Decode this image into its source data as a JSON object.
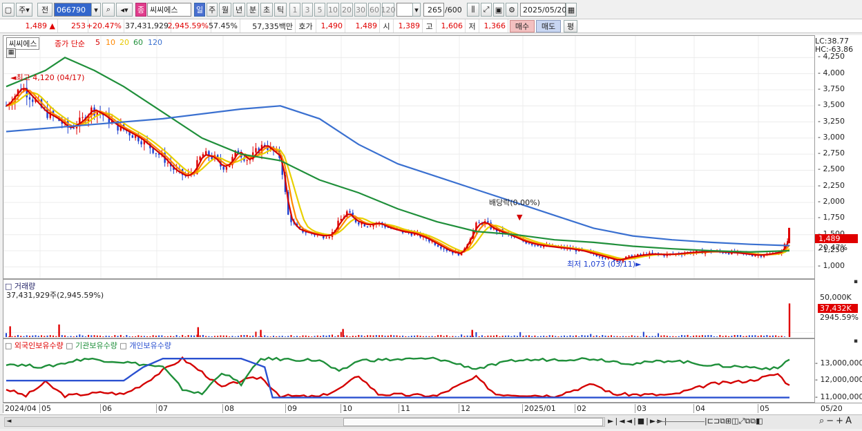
{
  "toolbar": {
    "week_label": "주",
    "prev_label": "전",
    "code": "066790",
    "name_badge": "종",
    "stock_name": "씨씨에스",
    "periods": [
      "일",
      "주",
      "월",
      "년",
      "분",
      "초",
      "틱"
    ],
    "intervals": [
      "1",
      "3",
      "5",
      "10",
      "20",
      "30",
      "60",
      "120"
    ],
    "count": "265",
    "total": "/600",
    "date": "2025/05/20"
  },
  "quote": {
    "price": "1,489",
    "arrow": "▲",
    "change": "253",
    "change_pct": "+20.47%",
    "volume": "37,431,929",
    "volume_pct": "2,945.59%",
    "turnover_ratio": "57.45%",
    "amount": "57,335백만",
    "hoga_label": "호가",
    "ask": "1,490",
    "bid": "1,489",
    "open_label": "시",
    "open": "1,389",
    "high_label": "고",
    "high": "1,606",
    "low_label": "저",
    "low": "1,366",
    "buy_label": "매수",
    "sell_label": "매도",
    "eval_label": "평"
  },
  "price_panel": {
    "stock_tag": "씨씨에스",
    "ma_label": "종가 단순",
    "ma_periods": [
      {
        "label": "5",
        "color": "#d40000"
      },
      {
        "label": "10",
        "color": "#ff8800"
      },
      {
        "label": "20",
        "color": "#e8d000"
      },
      {
        "label": "60",
        "color": "#1f8f3a"
      },
      {
        "label": "120",
        "color": "#3a70d0"
      }
    ],
    "lc": "LC:38.77",
    "hc": "HC:-63.86",
    "high_annotation": "최고 4,120 (04/17)",
    "low_annotation": "최저 1,073 (03/11)",
    "dividend_annotation": "배당락(0.00%)",
    "price_tag": "1,489",
    "pct_tag": "20.47%",
    "y_ticks": [
      "4,250",
      "4,000",
      "3,750",
      "3,500",
      "3,250",
      "3,000",
      "2,750",
      "2,500",
      "2,250",
      "2,000",
      "1,750",
      "1,500",
      "1,250",
      "1,000"
    ]
  },
  "volume_panel": {
    "title": "거래량",
    "value": "37,431,929주(2,945.59%)",
    "tick": "50,000K",
    "vol_tag": "37,432K",
    "pct_tag": "2945.59%"
  },
  "holding_panel": {
    "legends": [
      {
        "label": "외국인보유수량",
        "color": "#d40000"
      },
      {
        "label": "기관보유수량",
        "color": "#1f8f3a"
      },
      {
        "label": "개인보유수량",
        "color": "#2a50d0"
      }
    ],
    "y_ticks": [
      "13,000,000",
      "12,000,000",
      "11,000,000"
    ]
  },
  "x_axis": [
    "2024/04",
    "05",
    "06",
    "07",
    "08",
    "09",
    "10",
    "11",
    "12",
    "2025/01",
    "02",
    "03",
    "04",
    "05",
    "05/20"
  ],
  "chart_data": {
    "type": "candlestick",
    "price_range": [
      950,
      4350
    ],
    "ma_periods": [
      5,
      10,
      20,
      60,
      120
    ],
    "high": {
      "label": "최고",
      "value": 4120,
      "date": "04/17"
    },
    "low": {
      "label": "최저",
      "value": 1073,
      "date": "03/11"
    },
    "last_close": 1489,
    "last_change_pct": 20.47,
    "close_path": [
      [
        0,
        3500
      ],
      [
        8,
        3800
      ],
      [
        14,
        3600
      ],
      [
        20,
        3400
      ],
      [
        26,
        3300
      ],
      [
        32,
        3150
      ],
      [
        38,
        3250
      ],
      [
        44,
        3450
      ],
      [
        50,
        3350
      ],
      [
        56,
        3200
      ],
      [
        62,
        3100
      ],
      [
        68,
        3000
      ],
      [
        74,
        2850
      ],
      [
        80,
        2700
      ],
      [
        86,
        2500
      ],
      [
        92,
        2400
      ],
      [
        96,
        2500
      ],
      [
        100,
        2750
      ],
      [
        106,
        2700
      ],
      [
        110,
        2550
      ],
      [
        114,
        2600
      ],
      [
        118,
        2800
      ],
      [
        124,
        2650
      ],
      [
        128,
        2800
      ],
      [
        132,
        2900
      ],
      [
        136,
        2800
      ],
      [
        140,
        2700
      ],
      [
        144,
        1800
      ],
      [
        148,
        1600
      ],
      [
        152,
        1550
      ],
      [
        158,
        1500
      ],
      [
        162,
        1480
      ],
      [
        166,
        1500
      ],
      [
        170,
        1700
      ],
      [
        174,
        1850
      ],
      [
        178,
        1720
      ],
      [
        184,
        1650
      ],
      [
        190,
        1680
      ],
      [
        196,
        1600
      ],
      [
        202,
        1550
      ],
      [
        208,
        1520
      ],
      [
        214,
        1450
      ],
      [
        220,
        1350
      ],
      [
        226,
        1250
      ],
      [
        232,
        1200
      ],
      [
        236,
        1400
      ],
      [
        240,
        1650
      ],
      [
        244,
        1700
      ],
      [
        248,
        1600
      ],
      [
        252,
        1550
      ],
      [
        258,
        1480
      ],
      [
        264,
        1400
      ],
      [
        270,
        1350
      ],
      [
        276,
        1320
      ],
      [
        282,
        1300
      ],
      [
        288,
        1280
      ],
      [
        294,
        1250
      ],
      [
        300,
        1200
      ],
      [
        306,
        1150
      ],
      [
        312,
        1100
      ],
      [
        318,
        1150
      ],
      [
        324,
        1180
      ],
      [
        330,
        1200
      ],
      [
        336,
        1190
      ],
      [
        342,
        1200
      ],
      [
        348,
        1220
      ],
      [
        354,
        1230
      ],
      [
        360,
        1240
      ],
      [
        366,
        1230
      ],
      [
        372,
        1220
      ],
      [
        378,
        1200
      ],
      [
        384,
        1180
      ],
      [
        390,
        1200
      ],
      [
        396,
        1236
      ],
      [
        400,
        1489
      ]
    ],
    "ma120_path": [
      [
        0,
        3100
      ],
      [
        40,
        3200
      ],
      [
        80,
        3300
      ],
      [
        120,
        3450
      ],
      [
        140,
        3500
      ],
      [
        160,
        3300
      ],
      [
        180,
        2900
      ],
      [
        200,
        2600
      ],
      [
        220,
        2400
      ],
      [
        240,
        2200
      ],
      [
        260,
        2000
      ],
      [
        280,
        1800
      ],
      [
        300,
        1600
      ],
      [
        320,
        1480
      ],
      [
        340,
        1420
      ],
      [
        360,
        1380
      ],
      [
        380,
        1350
      ],
      [
        400,
        1330
      ]
    ],
    "ma60_path": [
      [
        0,
        3800
      ],
      [
        20,
        4050
      ],
      [
        30,
        4250
      ],
      [
        45,
        4050
      ],
      [
        60,
        3800
      ],
      [
        80,
        3400
      ],
      [
        100,
        3000
      ],
      [
        120,
        2750
      ],
      [
        140,
        2650
      ],
      [
        160,
        2350
      ],
      [
        180,
        2150
      ],
      [
        200,
        1900
      ],
      [
        220,
        1700
      ],
      [
        240,
        1550
      ],
      [
        260,
        1500
      ],
      [
        280,
        1420
      ],
      [
        300,
        1380
      ],
      [
        320,
        1320
      ],
      [
        340,
        1280
      ],
      [
        360,
        1250
      ],
      [
        380,
        1230
      ],
      [
        400,
        1250
      ]
    ],
    "volume_peaks": [
      {
        "pos": 2,
        "value": 12000
      },
      {
        "pos": 27,
        "value": 14000
      },
      {
        "pos": 98,
        "value": 11000
      },
      {
        "pos": 130,
        "value": 8000
      },
      {
        "pos": 172,
        "value": 9000
      },
      {
        "pos": 238,
        "value": 8000
      },
      {
        "pos": 400,
        "value": 37432
      }
    ],
    "holding_series": [
      {
        "name": "외국인보유수량",
        "path": [
          [
            0,
            11500
          ],
          [
            10,
            11100
          ],
          [
            20,
            11900
          ],
          [
            30,
            11100
          ],
          [
            40,
            11200
          ],
          [
            50,
            11300
          ],
          [
            60,
            11200
          ],
          [
            70,
            11800
          ],
          [
            80,
            12600
          ],
          [
            90,
            13300
          ],
          [
            100,
            12500
          ],
          [
            110,
            11600
          ],
          [
            120,
            12000
          ],
          [
            130,
            12200
          ],
          [
            140,
            11100
          ],
          [
            160,
            11050
          ],
          [
            170,
            11500
          ],
          [
            180,
            12300
          ],
          [
            190,
            11200
          ],
          [
            220,
            11100
          ],
          [
            240,
            12200
          ],
          [
            250,
            11200
          ],
          [
            280,
            11100
          ],
          [
            300,
            11800
          ],
          [
            310,
            11200
          ],
          [
            340,
            11150
          ],
          [
            360,
            11800
          ],
          [
            380,
            12000
          ],
          [
            394,
            12400
          ],
          [
            400,
            11700
          ]
        ]
      },
      {
        "name": "기관보유수량",
        "path": [
          [
            0,
            13000
          ],
          [
            20,
            12800
          ],
          [
            40,
            13300
          ],
          [
            60,
            13100
          ],
          [
            80,
            12800
          ],
          [
            90,
            11500
          ],
          [
            100,
            11200
          ],
          [
            110,
            12500
          ],
          [
            120,
            11800
          ],
          [
            130,
            13300
          ],
          [
            160,
            13200
          ],
          [
            170,
            12500
          ],
          [
            180,
            13200
          ],
          [
            220,
            13300
          ],
          [
            240,
            12700
          ],
          [
            260,
            13200
          ],
          [
            300,
            13300
          ],
          [
            320,
            13000
          ],
          [
            340,
            13200
          ],
          [
            360,
            12900
          ],
          [
            380,
            12800
          ],
          [
            394,
            12700
          ],
          [
            400,
            13300
          ]
        ]
      },
      {
        "name": "개인보유수량",
        "path": [
          [
            0,
            12000
          ],
          [
            60,
            12000
          ],
          [
            70,
            12800
          ],
          [
            80,
            13300
          ],
          [
            120,
            13300
          ],
          [
            132,
            12800
          ],
          [
            136,
            11000
          ],
          [
            270,
            11000
          ],
          [
            400,
            11000
          ]
        ]
      }
    ]
  }
}
